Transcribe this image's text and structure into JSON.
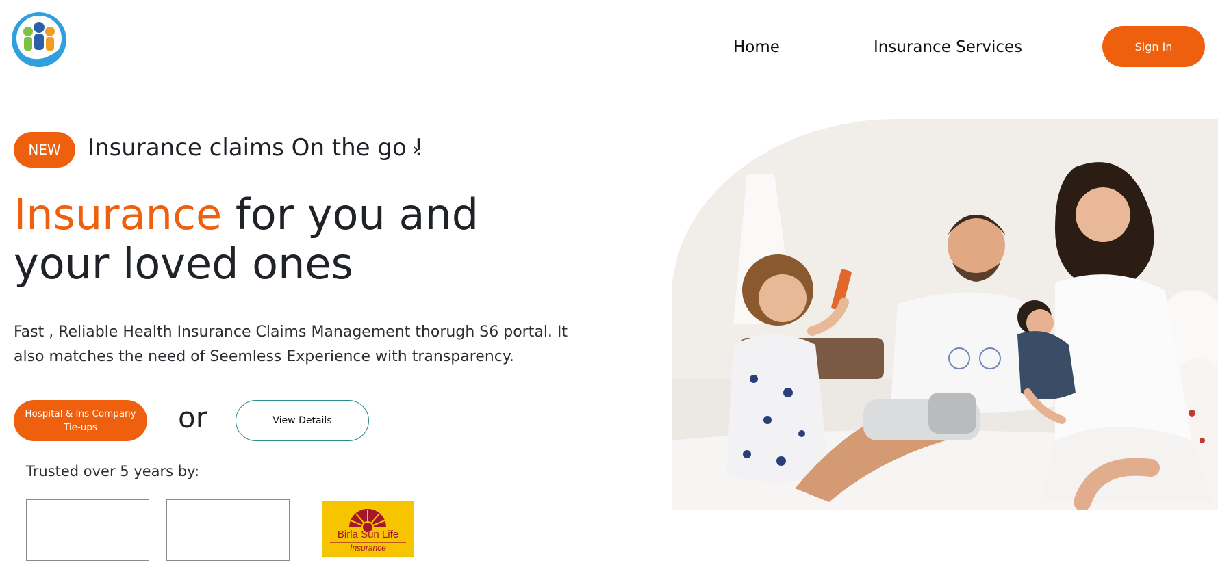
{
  "header": {
    "nav": {
      "home": "Home",
      "services": "Insurance Services"
    },
    "sign_in": "Sign In"
  },
  "announcement": {
    "badge": "NEW",
    "text": "Insurance claims On the go !",
    "chevron": "›"
  },
  "hero": {
    "headline_accent": "Insurance",
    "headline_line1_rest": " for you and",
    "headline_line2": "your loved ones",
    "description": "Fast , Reliable Health Insurance Claims Management thorugh S6 portal. It also matches the need of Seemless Experience with transparency."
  },
  "cta": {
    "primary_line1": "Hospital & Ins Company",
    "primary_line2": "Tie-ups",
    "or": "or",
    "secondary": "View Details"
  },
  "trusted": {
    "label": "Trusted over 5 years by:",
    "partner_logo_line1": "Birla Sun Life",
    "partner_logo_line2": "Insurance"
  },
  "colors": {
    "accent": "#ee600d",
    "text": "#1f2328",
    "secondary_border": "#2b8a8a",
    "birla_yellow": "#f7c400",
    "birla_red": "#a3162b"
  }
}
